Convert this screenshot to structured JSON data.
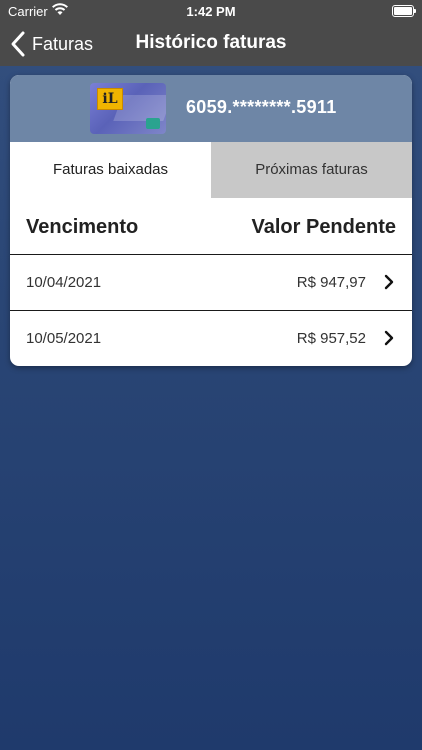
{
  "status_bar": {
    "carrier": "Carrier",
    "time": "1:42 PM"
  },
  "nav": {
    "back_label": "Faturas",
    "title": "Histórico faturas"
  },
  "card": {
    "number": "6059.********.5911",
    "logo_text": "iL"
  },
  "tabs": [
    {
      "label": "Faturas baixadas",
      "active": true
    },
    {
      "label": "Próximas faturas",
      "active": false
    }
  ],
  "table": {
    "headers": {
      "col1": "Vencimento",
      "col2": "Valor Pendente"
    },
    "rows": [
      {
        "date": "10/04/2021",
        "value": "R$ 947,97"
      },
      {
        "date": "10/05/2021",
        "value": "R$ 957,52"
      }
    ]
  },
  "colors": {
    "top_bar": "#4a4a4a",
    "background_top": "#34507f",
    "background_bottom": "#1f3a6c",
    "card_header": "#6e86a6",
    "inactive_tab": "#c8c8c8"
  }
}
